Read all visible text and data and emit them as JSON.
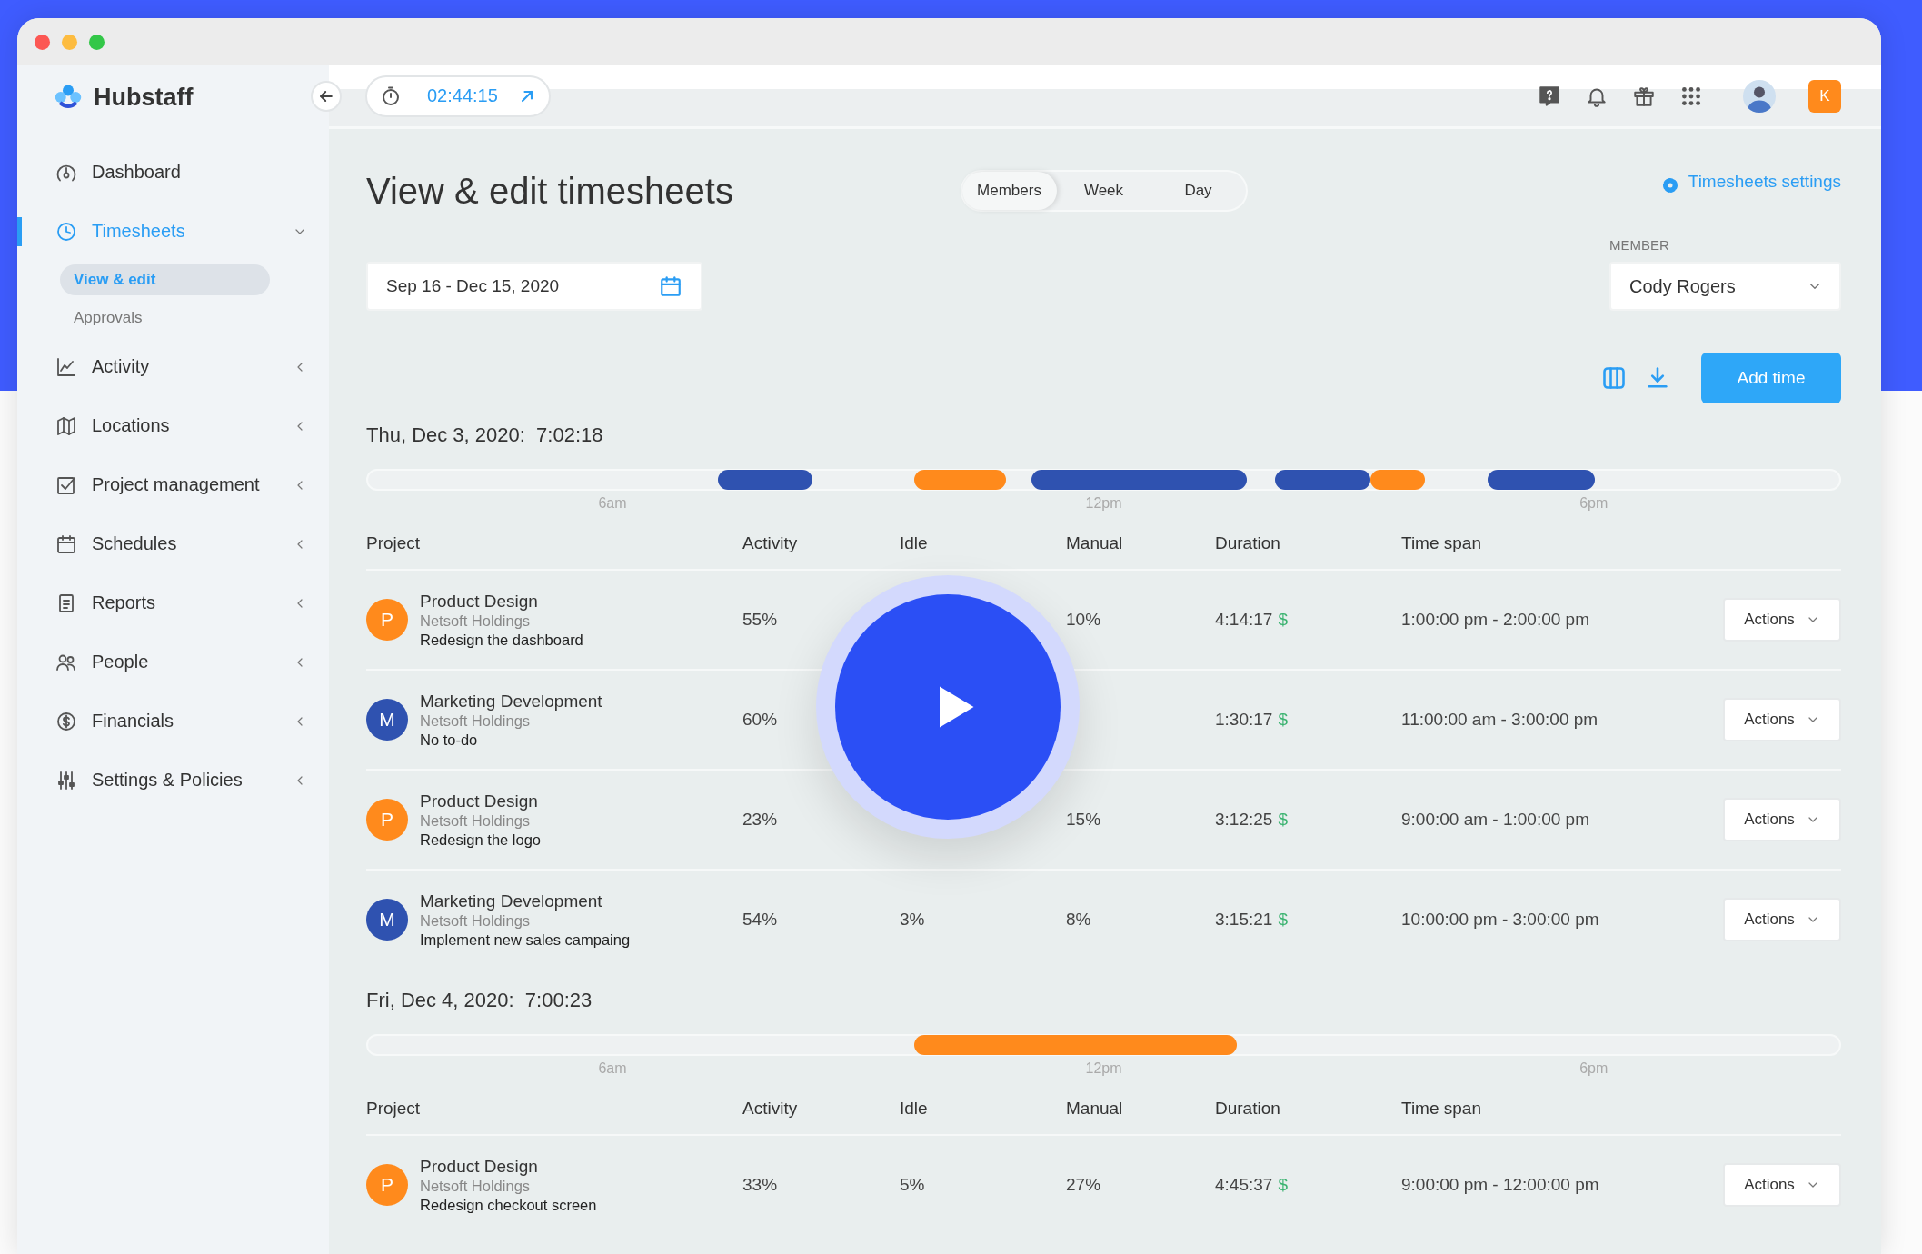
{
  "app": {
    "name": "Hubstaff"
  },
  "sidebar": {
    "items": [
      {
        "label": "Dashboard",
        "kind": "link",
        "selected": false
      },
      {
        "label": "Timesheets",
        "kind": "group",
        "selected": true,
        "expanded": true,
        "children": [
          {
            "label": "View & edit",
            "selected": true
          },
          {
            "label": "Approvals",
            "selected": false
          }
        ]
      },
      {
        "label": "Activity",
        "kind": "group",
        "selected": false,
        "expanded": false
      },
      {
        "label": "Locations",
        "kind": "group",
        "selected": false,
        "expanded": false
      },
      {
        "label": "Project management",
        "kind": "group",
        "selected": false,
        "expanded": false
      },
      {
        "label": "Schedules",
        "kind": "group",
        "selected": false,
        "expanded": false
      },
      {
        "label": "Reports",
        "kind": "group",
        "selected": false,
        "expanded": false
      },
      {
        "label": "People",
        "kind": "group",
        "selected": false,
        "expanded": false
      },
      {
        "label": "Financials",
        "kind": "group",
        "selected": false,
        "expanded": false
      },
      {
        "label": "Settings & Policies",
        "kind": "group",
        "selected": false,
        "expanded": false
      }
    ]
  },
  "topbar": {
    "timer": "02:44:15",
    "account_initial": "K"
  },
  "page": {
    "title": "View & edit timesheets",
    "view_tabs": [
      {
        "label": "Members",
        "selected": true
      },
      {
        "label": "Week",
        "selected": false
      },
      {
        "label": "Day",
        "selected": false
      }
    ],
    "settings_link": "Timesheets settings",
    "date_range": "Sep 16 - Dec 15, 2020",
    "member": {
      "label": "MEMBER",
      "value": "Cody Rogers"
    },
    "add_button": "Add time"
  },
  "days": [
    {
      "heading": "Thu, Dec 3, 2020:  7:02:18",
      "ticks": [
        "6am",
        "12pm",
        "6pm"
      ],
      "segments": [
        {
          "color": "#2f52b0"
        },
        {
          "color": "#ff8a1c"
        },
        {
          "color": "#2f52b0"
        },
        {
          "color": "#2f52b0"
        },
        {
          "color": "#ff8a1c"
        },
        {
          "color": "#2f52b0"
        }
      ],
      "columns": [
        "Project",
        "Activity",
        "Idle",
        "Manual",
        "Duration",
        "Time span"
      ],
      "rows": [
        {
          "initial": "P",
          "color": "#ff8a1c",
          "project": "Product Design",
          "client": "Netsoft Holdings",
          "task": "Redesign the dashboard",
          "activity": "55%",
          "manual": "10%",
          "duration": "4:14:17",
          "money_mark": "$",
          "time_span": "1:00:00 pm - 2:00:00 pm",
          "action": "Actions"
        },
        {
          "initial": "M",
          "color": "#2f52b0",
          "project": "Marketing Development",
          "client": "Netsoft Holdings",
          "task": "No to-do",
          "activity": "60%",
          "duration": "1:30:17",
          "money_mark": "$",
          "time_span": "11:00:00 am - 3:00:00 pm",
          "action": "Actions"
        },
        {
          "initial": "P",
          "color": "#ff8a1c",
          "project": "Product Design",
          "client": "Netsoft Holdings",
          "task": "Redesign the logo",
          "activity": "23%",
          "manual": "15%",
          "duration": "3:12:25",
          "money_mark": "$",
          "time_span": "9:00:00 am - 1:00:00 pm",
          "action": "Actions"
        },
        {
          "initial": "M",
          "color": "#2f52b0",
          "project": "Marketing Development",
          "client": "Netsoft Holdings",
          "task": "Implement new sales campaing",
          "activity": "54%",
          "idle": "3%",
          "manual": "8%",
          "duration": "3:15:21",
          "money_mark": "$",
          "time_span": "10:00:00 pm - 3:00:00 pm",
          "action": "Actions"
        }
      ]
    },
    {
      "heading": "Fri, Dec 4, 2020:  7:00:23",
      "ticks": [
        "6am",
        "12pm",
        "6pm"
      ],
      "segments": [
        {
          "color": "#ff8a1c"
        }
      ],
      "columns": [
        "Project",
        "Activity",
        "Idle",
        "Manual",
        "Duration",
        "Time span"
      ],
      "rows": [
        {
          "initial": "P",
          "color": "#ff8a1c",
          "project": "Product Design",
          "client": "Netsoft Holdings",
          "task": "Redesign checkout screen",
          "activity": "33%",
          "idle": "5%",
          "manual": "27%",
          "duration": "4:45:37",
          "money_mark": "$",
          "time_span": "9:00:00 pm - 12:00:00 pm",
          "action": "Actions"
        }
      ]
    }
  ]
}
